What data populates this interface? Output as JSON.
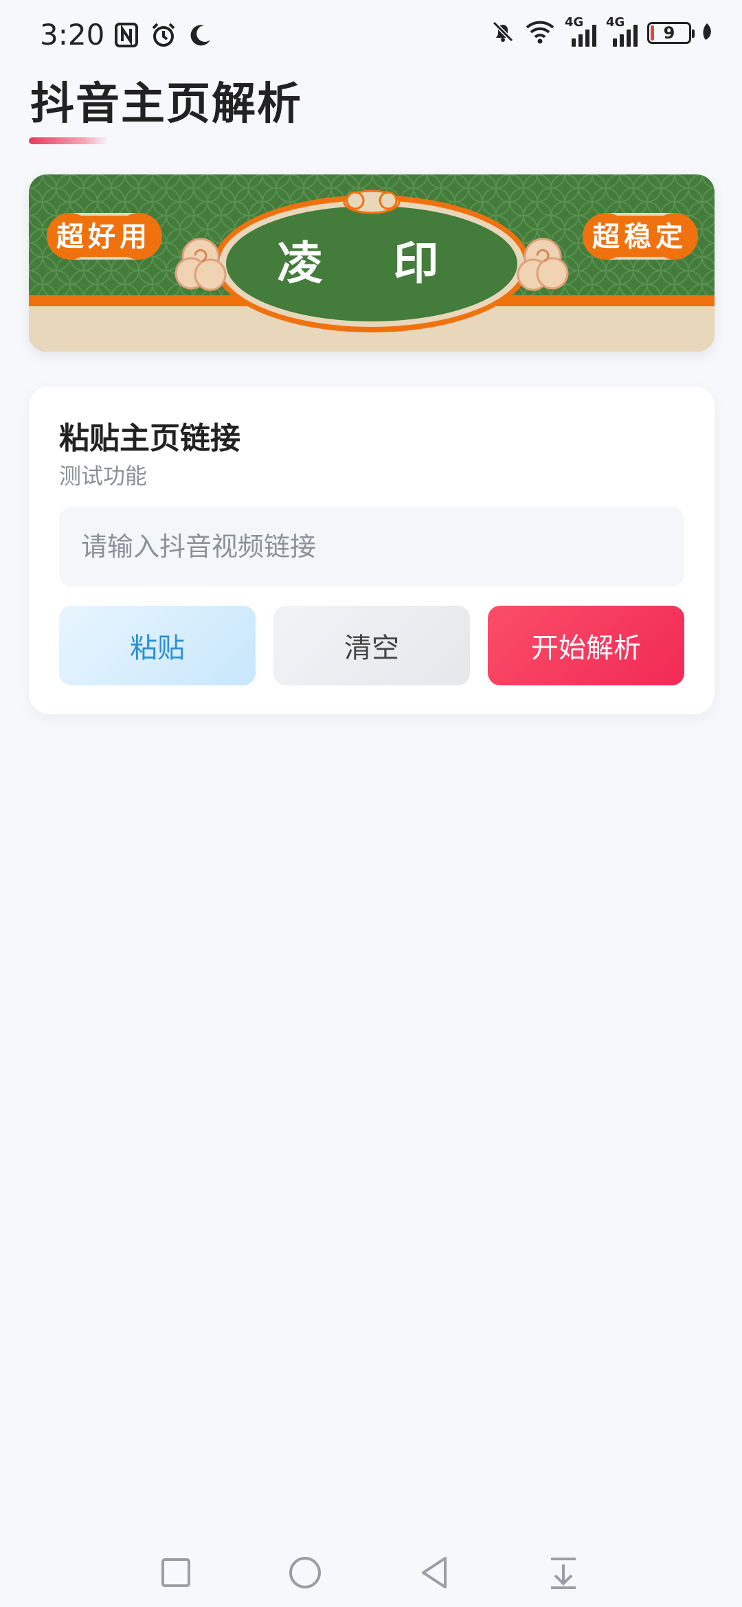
{
  "status_bar": {
    "time": "3:20",
    "battery_level": "9",
    "network_1": "4G",
    "network_2": "4G",
    "icons": [
      "nfc-icon",
      "alarm-icon",
      "moon-icon",
      "bell-muted-icon",
      "wifi-icon",
      "signal-icon",
      "signal-icon",
      "battery-icon",
      "leaf-icon"
    ]
  },
  "page": {
    "title": "抖音主页解析"
  },
  "banner": {
    "left_badge": "超好用",
    "right_badge": "超稳定",
    "center_text": "凌 印",
    "colors": {
      "green": "#447c3c",
      "orange": "#f0720f",
      "cream": "#e9d7bb"
    }
  },
  "card": {
    "title": "粘贴主页链接",
    "subtitle": "测试功能",
    "input_placeholder": "请输入抖音视频链接",
    "input_value": "",
    "buttons": {
      "paste": "粘贴",
      "clear": "清空",
      "parse": "开始解析"
    }
  },
  "nav_bar": {
    "icons": [
      "recent-apps-icon",
      "home-icon",
      "back-icon",
      "drawer-icon"
    ]
  },
  "colors": {
    "accent": "#f12a55",
    "paste_text": "#2d8fd1",
    "background": "#f7f8fb"
  }
}
